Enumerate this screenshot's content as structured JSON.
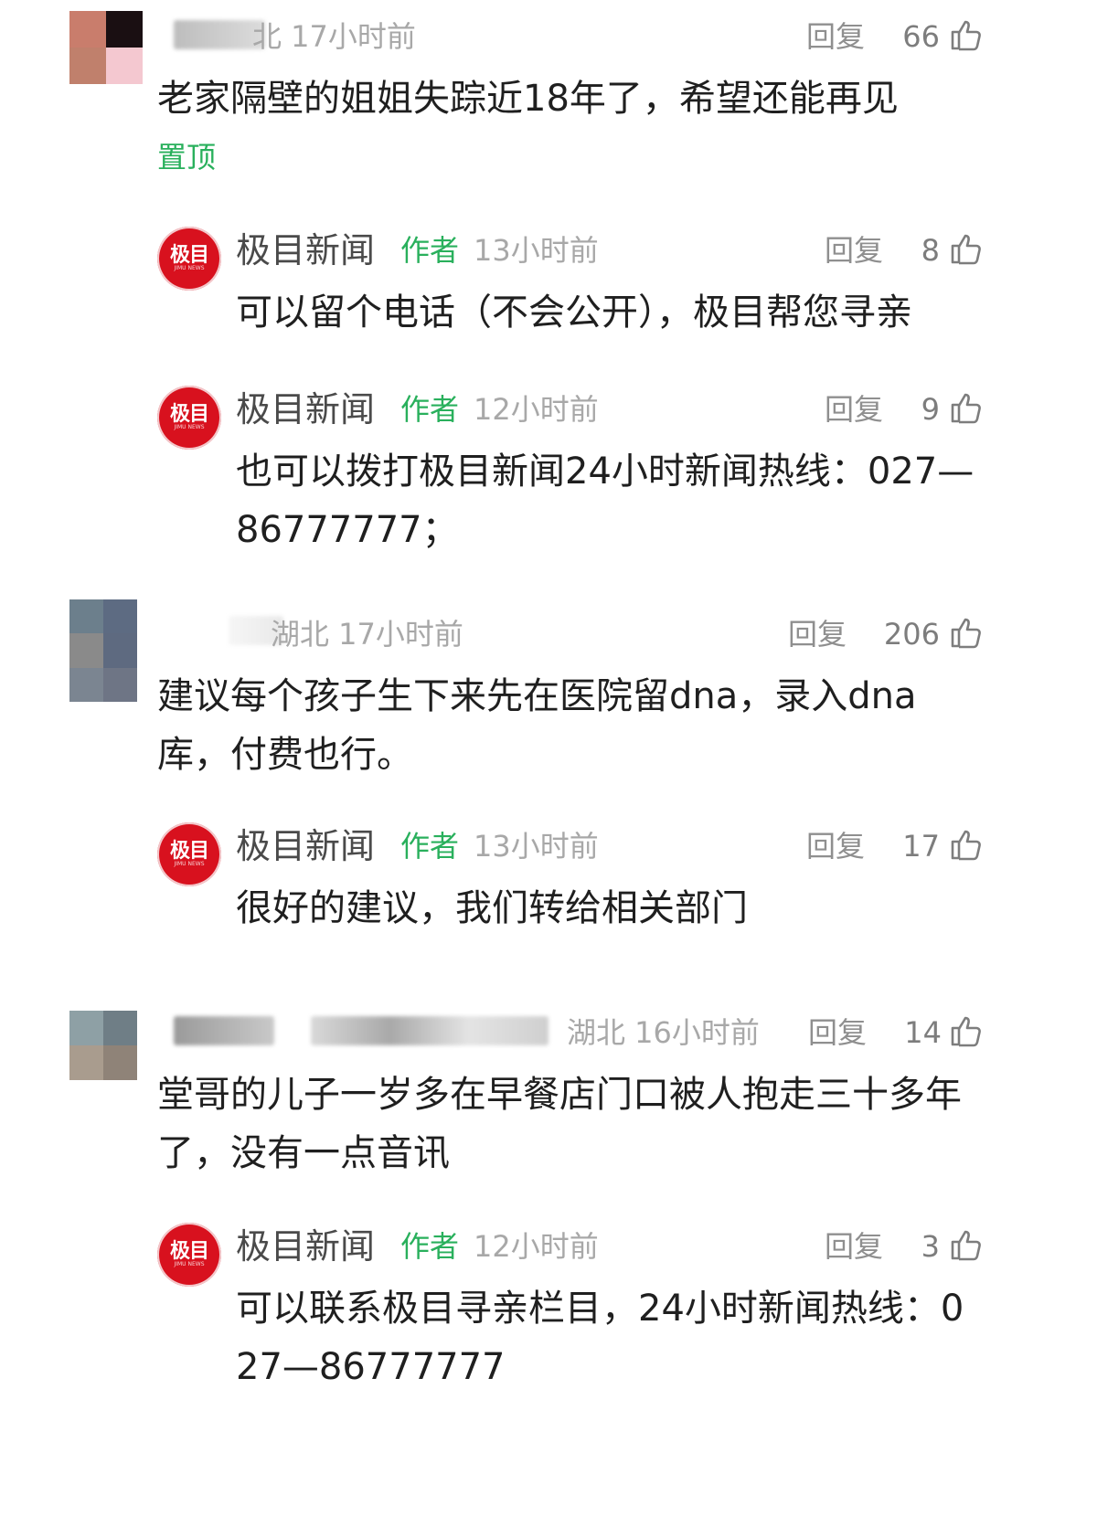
{
  "colors": {
    "author_tag": "#29b05c",
    "brand_red": "#d8111e",
    "meta_gray": "#a8a8a8",
    "text": "#1f1f1f"
  },
  "icons": {
    "like": "thumbs-up-icon",
    "avatar_brand": "jimu-news-logo"
  },
  "comments": [
    {
      "location_time": "北 17小时前",
      "reply": "回复",
      "likes": "66",
      "text": "老家隔壁的姐姐失踪近18年了，希望还能再见",
      "pin": "置顶",
      "replies": [
        {
          "author": "极目新闻",
          "tag": "作者",
          "time": "13小时前",
          "reply": "回复",
          "likes": "8",
          "text": "可以留个电话（不会公开），极目帮您寻亲"
        },
        {
          "author": "极目新闻",
          "tag": "作者",
          "time": "12小时前",
          "reply": "回复",
          "likes": "9",
          "text": "也可以拨打极目新闻24小时新闻热线：027—86777777；"
        }
      ]
    },
    {
      "location_time": "湖北 17小时前",
      "reply": "回复",
      "likes": "206",
      "text": "建议每个孩子生下来先在医院留dna，录入dna库，付费也行。",
      "replies": [
        {
          "author": "极目新闻",
          "tag": "作者",
          "time": "13小时前",
          "reply": "回复",
          "likes": "17",
          "text": "很好的建议，我们转给相关部门"
        }
      ]
    },
    {
      "location_time": "湖北 16小时前",
      "reply": "回复",
      "likes": "14",
      "text": "堂哥的儿子一岁多在早餐店门口被人抱走三十多年了，没有一点音讯",
      "replies": [
        {
          "author": "极目新闻",
          "tag": "作者",
          "time": "12小时前",
          "reply": "回复",
          "likes": "3",
          "text": "可以联系极目寻亲栏目，24小时新闻热线：027—86777777"
        }
      ]
    }
  ],
  "brand_logo": {
    "main": "极目",
    "sub": "JIMU NEWS"
  }
}
